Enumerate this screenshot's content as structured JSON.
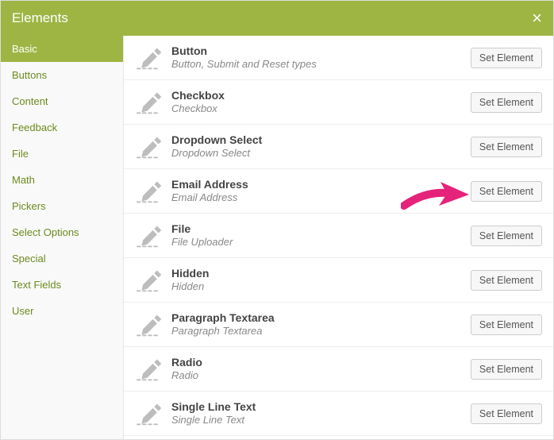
{
  "header": {
    "title": "Elements"
  },
  "sidebar": {
    "items": [
      {
        "label": "Basic",
        "active": true
      },
      {
        "label": "Buttons",
        "active": false
      },
      {
        "label": "Content",
        "active": false
      },
      {
        "label": "Feedback",
        "active": false
      },
      {
        "label": "File",
        "active": false
      },
      {
        "label": "Math",
        "active": false
      },
      {
        "label": "Pickers",
        "active": false
      },
      {
        "label": "Select Options",
        "active": false
      },
      {
        "label": "Special",
        "active": false
      },
      {
        "label": "Text Fields",
        "active": false
      },
      {
        "label": "User",
        "active": false
      }
    ]
  },
  "elements": [
    {
      "title": "Button",
      "desc": "Button, Submit and Reset types",
      "button": "Set Element"
    },
    {
      "title": "Checkbox",
      "desc": "Checkbox",
      "button": "Set Element"
    },
    {
      "title": "Dropdown Select",
      "desc": "Dropdown Select",
      "button": "Set Element"
    },
    {
      "title": "Email Address",
      "desc": "Email Address",
      "button": "Set Element"
    },
    {
      "title": "File",
      "desc": "File Uploader",
      "button": "Set Element"
    },
    {
      "title": "Hidden",
      "desc": "Hidden",
      "button": "Set Element"
    },
    {
      "title": "Paragraph Textarea",
      "desc": "Paragraph Textarea",
      "button": "Set Element"
    },
    {
      "title": "Radio",
      "desc": "Radio",
      "button": "Set Element"
    },
    {
      "title": "Single Line Text",
      "desc": "Single Line Text",
      "button": "Set Element"
    }
  ],
  "colors": {
    "accent": "#9eb544",
    "sidebar_link": "#6c8a1e",
    "arrow": "#e6237a"
  }
}
